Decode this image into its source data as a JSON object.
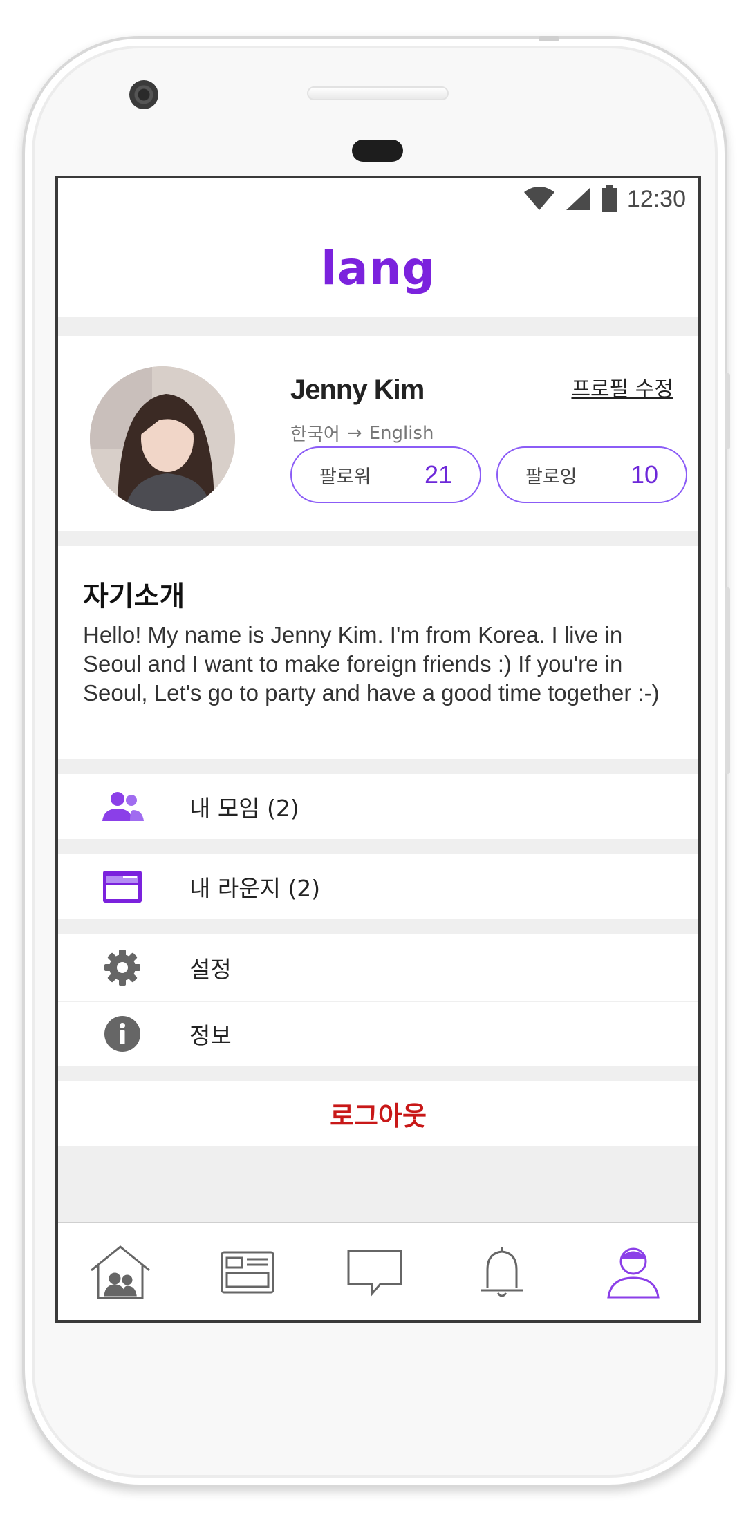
{
  "status_bar": {
    "time": "12:30",
    "icons": [
      "wifi-icon",
      "signal-icon",
      "battery-icon"
    ]
  },
  "app_bar": {
    "brand": "lang"
  },
  "profile": {
    "name": "Jenny Kim",
    "edit_label": "프로필 수정",
    "languages": {
      "native": "한국어",
      "arrow": "→",
      "learning": "English"
    },
    "follower_label": "팔로워",
    "follower_count": "21",
    "following_label": "팔로잉",
    "following_count": "10"
  },
  "intro": {
    "title": "자기소개",
    "text": "Hello! My name is Jenny Kim. I'm from Korea. I live in Seoul and I want to make foreign friends :) If you're in Seoul, Let's go to party and have a good time together :-)"
  },
  "menu": {
    "my_groups": "내 모임 (2)",
    "my_lounges": "내 라운지 (2)",
    "settings": "설정",
    "info": "정보"
  },
  "logout_label": "로그아웃",
  "bottom_nav": [
    "home-icon",
    "lounge-icon",
    "chat-icon",
    "bell-icon",
    "profile-icon"
  ],
  "colors": {
    "brand": "#7b22dd",
    "accent": "#8b5cf6",
    "logout": "#c81818",
    "icon_gray": "#666666"
  }
}
